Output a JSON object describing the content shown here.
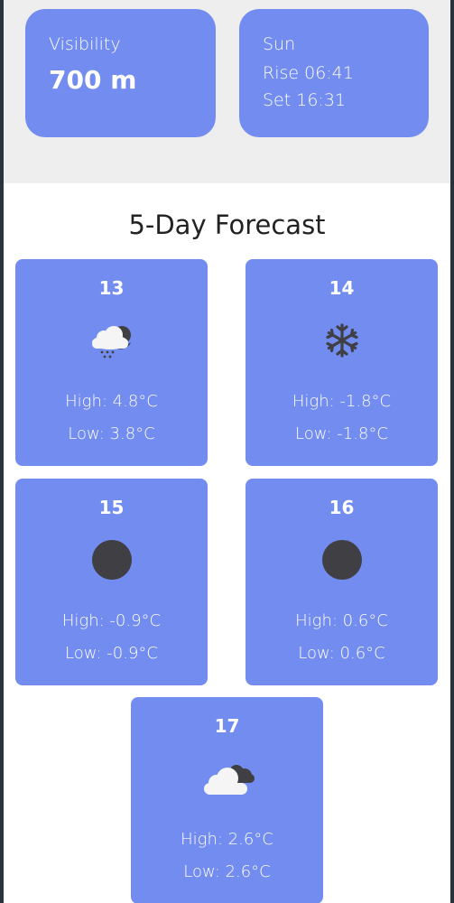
{
  "stats": {
    "visibility": {
      "label": "Visibility",
      "value": "700 m"
    },
    "sun": {
      "label": "Sun",
      "rise": "Rise 06:41",
      "set": "Set 16:31"
    }
  },
  "colors": {
    "card": "#738cf0",
    "icon_dark": "#3f3f44",
    "page_bg": "#ffffff",
    "top_bg": "#eeeeee"
  },
  "forecast": {
    "title": "5-Day Forecast",
    "days": [
      {
        "day": "13",
        "icon": "rain-cloud-moon-icon",
        "high": "High: 4.8°C",
        "low": "Low: 3.8°C"
      },
      {
        "day": "14",
        "icon": "snowflake-icon",
        "high": "High: -1.8°C",
        "low": "Low: -1.8°C"
      },
      {
        "day": "15",
        "icon": "moon-icon",
        "high": "High: -0.9°C",
        "low": "Low: -0.9°C"
      },
      {
        "day": "16",
        "icon": "moon-icon",
        "high": "High: 0.6°C",
        "low": "Low: 0.6°C"
      },
      {
        "day": "17",
        "icon": "clouds-icon",
        "high": "High: 2.6°C",
        "low": "Low: 2.6°C"
      }
    ]
  }
}
